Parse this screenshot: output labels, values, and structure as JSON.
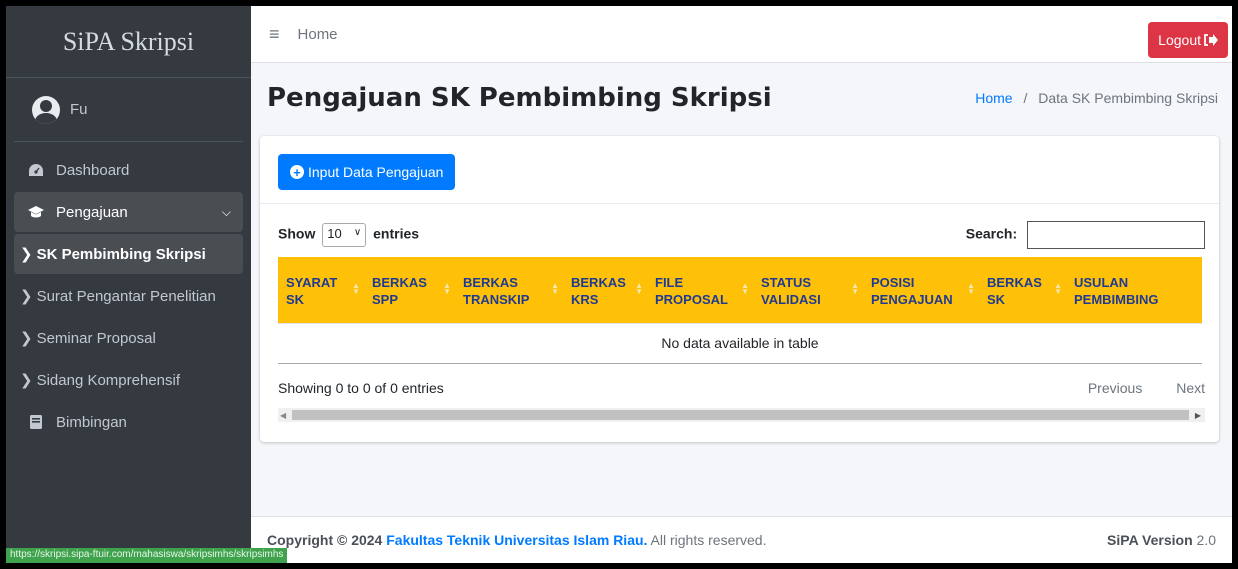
{
  "sidebar": {
    "brand": "SiPA Skripsi",
    "user_name": "Fu",
    "items": [
      {
        "label": "Dashboard"
      },
      {
        "label": "Pengajuan"
      },
      {
        "label": "SK Pembimbing Skripsi"
      },
      {
        "label": "Surat Pengantar Penelitian"
      },
      {
        "label": "Seminar Proposal"
      },
      {
        "label": "Sidang Komprehensif"
      },
      {
        "label": "Bimbingan"
      }
    ],
    "status_url": "https://skripsi.sipa-ftuir.com/mahasiswa/skripsimhs/skripsimhs"
  },
  "topbar": {
    "home": "Home",
    "logout": "Logout"
  },
  "header": {
    "title": "Pengajuan SK Pembimbing Skripsi",
    "breadcrumb_home": "Home",
    "breadcrumb_sep": "/",
    "breadcrumb_current": "Data SK Pembimbing Skripsi"
  },
  "card": {
    "input_button": "Input Data Pengajuan",
    "show_label": "Show",
    "entries_label": "entries",
    "length_value": "10",
    "search_label": "Search:",
    "columns": [
      {
        "l1": "SYARAT",
        "l2": "SK"
      },
      {
        "l1": "BERKAS",
        "l2": "SPP"
      },
      {
        "l1": "BERKAS",
        "l2": "TRANSKIP"
      },
      {
        "l1": "BERKAS",
        "l2": "KRS"
      },
      {
        "l1": "FILE",
        "l2": "PROPOSAL"
      },
      {
        "l1": "STATUS",
        "l2": "VALIDASI"
      },
      {
        "l1": "POSISI",
        "l2": "PENGAJUAN"
      },
      {
        "l1": "BERKAS",
        "l2": "SK"
      },
      {
        "l1": "USULAN",
        "l2": "PEMBIMBING"
      }
    ],
    "empty_text": "No data available in table",
    "info": "Showing 0 to 0 of 0 entries",
    "previous": "Previous",
    "next": "Next"
  },
  "footer": {
    "copyright": "Copyright © 2024",
    "faculty": "Fakultas Teknik Universitas Islam Riau.",
    "rights": "All rights reserved.",
    "version_label": "SiPA Version",
    "version_number": "2.0"
  },
  "colors": {
    "sidebar_bg": "#343a40",
    "table_header_bg": "#ffc107",
    "primary": "#007bff",
    "danger": "#dc3545"
  }
}
